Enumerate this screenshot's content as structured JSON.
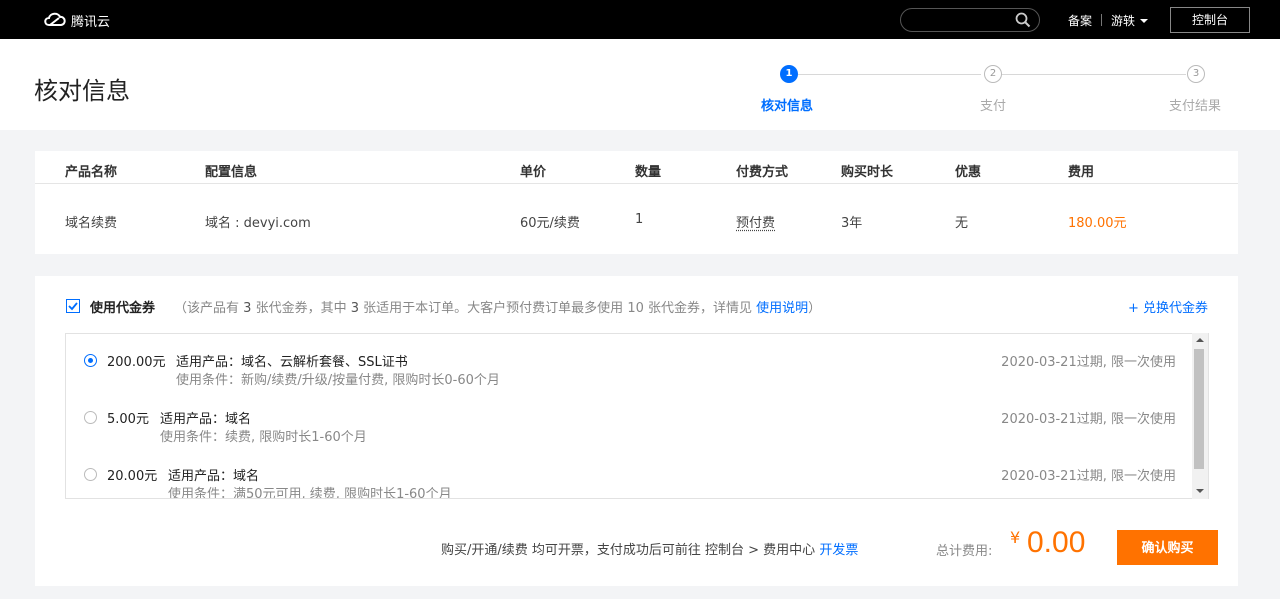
{
  "nav": {
    "brand": "腾讯云",
    "beian": "备案",
    "user": "游轶",
    "console": "控制台"
  },
  "page": {
    "title": "核对信息"
  },
  "steps": [
    {
      "num": "1",
      "label": "核对信息"
    },
    {
      "num": "2",
      "label": "支付"
    },
    {
      "num": "3",
      "label": "支付结果"
    }
  ],
  "order": {
    "headers": [
      "产品名称",
      "配置信息",
      "单价",
      "数量",
      "付费方式",
      "购买时长",
      "优惠",
      "费用"
    ],
    "row": [
      "域名续费",
      "域名 : devyi.com",
      "60元/续费",
      "1",
      "预付费",
      "3年",
      "无",
      "180.00元"
    ]
  },
  "voucher": {
    "title": "使用代金券",
    "desc_prefix": "（该产品有",
    "count_total": "3",
    "desc_mid1": "张代金券，其中",
    "count_usable": "3",
    "desc_mid2": "张适用于本订单。大客户预付费订单最多使用",
    "count_max": "10",
    "desc_mid3": "张代金券，详情见",
    "desc_link": "使用说明",
    "desc_suffix": "）",
    "redeem": "+ 兑换代金券",
    "items": [
      {
        "amount": "200.00元",
        "scope": "适用产品：域名、云解析套餐、SSL证书",
        "condition": "使用条件：新购/续费/升级/按量付费, 限购时长0-60个月",
        "expire": "2020-03-21过期, 限一次使用",
        "selected": true
      },
      {
        "amount": "5.00元",
        "scope": "适用产品：域名",
        "condition": "使用条件：续费, 限购时长1-60个月",
        "expire": "2020-03-21过期, 限一次使用",
        "selected": false
      },
      {
        "amount": "20.00元",
        "scope": "适用产品：域名",
        "condition": "使用条件：满50元可用, 续费, 限购时长1-60个月",
        "expire": "2020-03-21过期, 限一次使用",
        "selected": false
      }
    ]
  },
  "footer": {
    "invoice_note": "购买/开通/续费 均可开票，支付成功后可前往 控制台 > 费用中心",
    "invoice_link": "开发票",
    "total_label": "总计费用:",
    "currency": "¥",
    "total": "0.00",
    "buy": "确认购买"
  },
  "colors": {
    "accent": "#006eff",
    "price": "#ff7200"
  }
}
